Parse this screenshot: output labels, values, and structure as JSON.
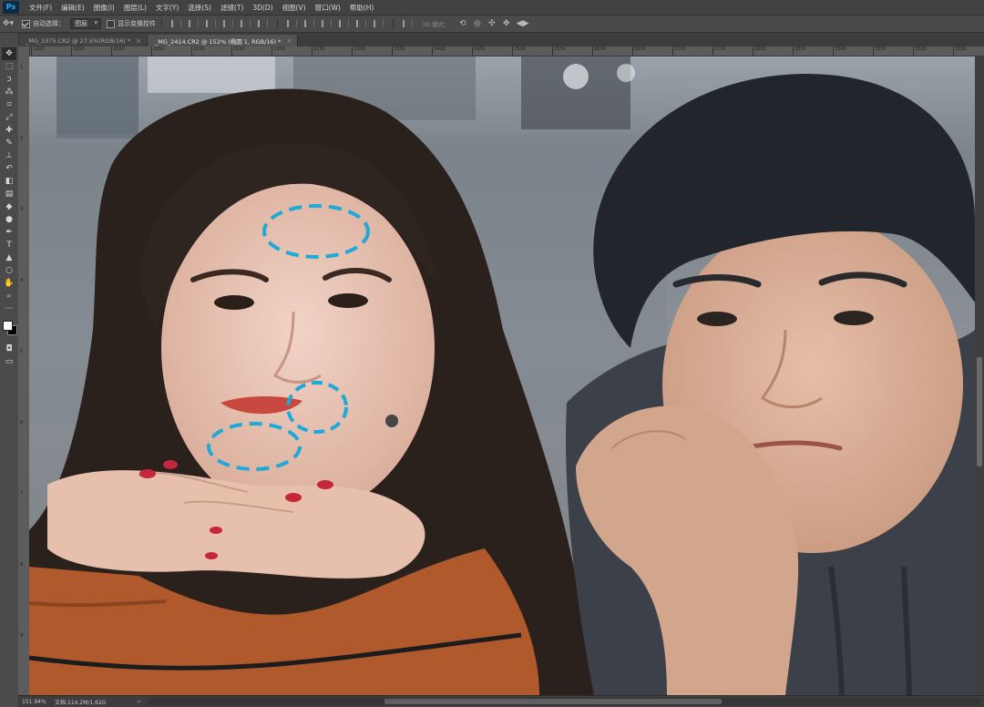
{
  "app": {
    "logo": "Ps"
  },
  "menu": [
    "文件(F)",
    "编辑(E)",
    "图像(I)",
    "图层(L)",
    "文字(Y)",
    "选择(S)",
    "滤镜(T)",
    "3D(D)",
    "视图(V)",
    "窗口(W)",
    "帮助(H)"
  ],
  "options": {
    "auto_select_label": "自动选择：",
    "auto_select_value": "图层",
    "show_transform_label": "显示变换控件",
    "mode_3d_label": "3D 模式："
  },
  "tabs": [
    {
      "label": "_MG_2375.CR2 @ 27.5%(RGB/16) *",
      "close": "×"
    },
    {
      "label": "_MG_2414.CR2 @ 152% (椭圆 1, RGB/16) *",
      "close": "×"
    }
  ],
  "ruler": {
    "h_ticks": [
      "1900",
      "1950",
      "2000",
      "2050",
      "2100",
      "2150",
      "2200",
      "2250",
      "2300",
      "2350",
      "2400",
      "2450",
      "2500",
      "2550",
      "2600",
      "2650",
      "2700",
      "2750",
      "2800",
      "2850",
      "2900",
      "2950",
      "3000",
      "3050"
    ],
    "v_ticks": [
      "1",
      "2",
      "3",
      "4",
      "5",
      "6",
      "7",
      "8",
      "9"
    ]
  },
  "status": {
    "zoom": "151.94%",
    "doc_info": "文档:114.2M/1.62G",
    "arrow": ">"
  },
  "tools": [
    {
      "name": "move-tool",
      "glyph": "✥"
    },
    {
      "name": "marquee-tool",
      "glyph": "⬚"
    },
    {
      "name": "lasso-tool",
      "glyph": "ↄ"
    },
    {
      "name": "quick-select-tool",
      "glyph": "⁂"
    },
    {
      "name": "crop-tool",
      "glyph": "⌗"
    },
    {
      "name": "eyedropper-tool",
      "glyph": "⤢"
    },
    {
      "name": "healing-brush-tool",
      "glyph": "✚"
    },
    {
      "name": "brush-tool",
      "glyph": "✎"
    },
    {
      "name": "clone-stamp-tool",
      "glyph": "⊥"
    },
    {
      "name": "history-brush-tool",
      "glyph": "↶"
    },
    {
      "name": "eraser-tool",
      "glyph": "◧"
    },
    {
      "name": "gradient-tool",
      "glyph": "▤"
    },
    {
      "name": "blur-tool",
      "glyph": "◆"
    },
    {
      "name": "dodge-tool",
      "glyph": "●"
    },
    {
      "name": "pen-tool",
      "glyph": "✒"
    },
    {
      "name": "type-tool",
      "glyph": "T"
    },
    {
      "name": "path-select-tool",
      "glyph": "▲"
    },
    {
      "name": "shape-tool",
      "glyph": "○"
    },
    {
      "name": "hand-tool",
      "glyph": "✋"
    },
    {
      "name": "zoom-tool",
      "glyph": "⌕"
    },
    {
      "name": "more-tools",
      "glyph": "⋯"
    }
  ],
  "colors": {
    "accent_dashed_ellipse": "#1fa9d6"
  }
}
